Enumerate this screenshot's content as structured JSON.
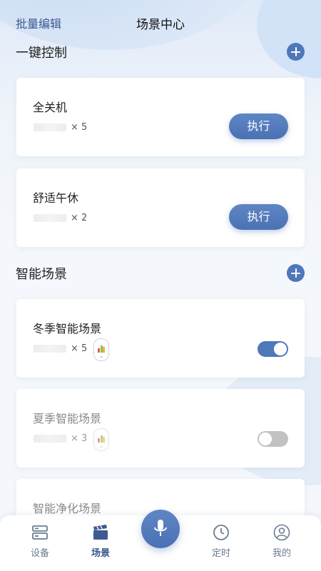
{
  "header": {
    "title": "场景中心",
    "batch_edit": "批量编辑"
  },
  "sections": {
    "one_key": {
      "title": "一键控制"
    },
    "smart": {
      "title": "智能场景"
    }
  },
  "one_key_cards": [
    {
      "name": "全关机",
      "count": "× 5",
      "action": "执行"
    },
    {
      "name": "舒适午休",
      "count": "× 2",
      "action": "执行"
    }
  ],
  "smart_cards": [
    {
      "name": "冬季智能场景",
      "count": "× 5",
      "enabled": true
    },
    {
      "name": "夏季智能场景",
      "count": "× 3",
      "enabled": false
    },
    {
      "name": "智能净化场景"
    }
  ],
  "tabbar": {
    "devices": "设备",
    "scenes": "场景",
    "timer": "定时",
    "mine": "我的"
  },
  "colors": {
    "accent": "#4f78bb",
    "accent_text": "#3c5a8e",
    "toggle_off": "#c2c2c2"
  },
  "icons": [
    "plus-icon",
    "mic-icon",
    "devices-icon",
    "scenes-icon",
    "clock-icon",
    "user-icon",
    "device-icon"
  ]
}
